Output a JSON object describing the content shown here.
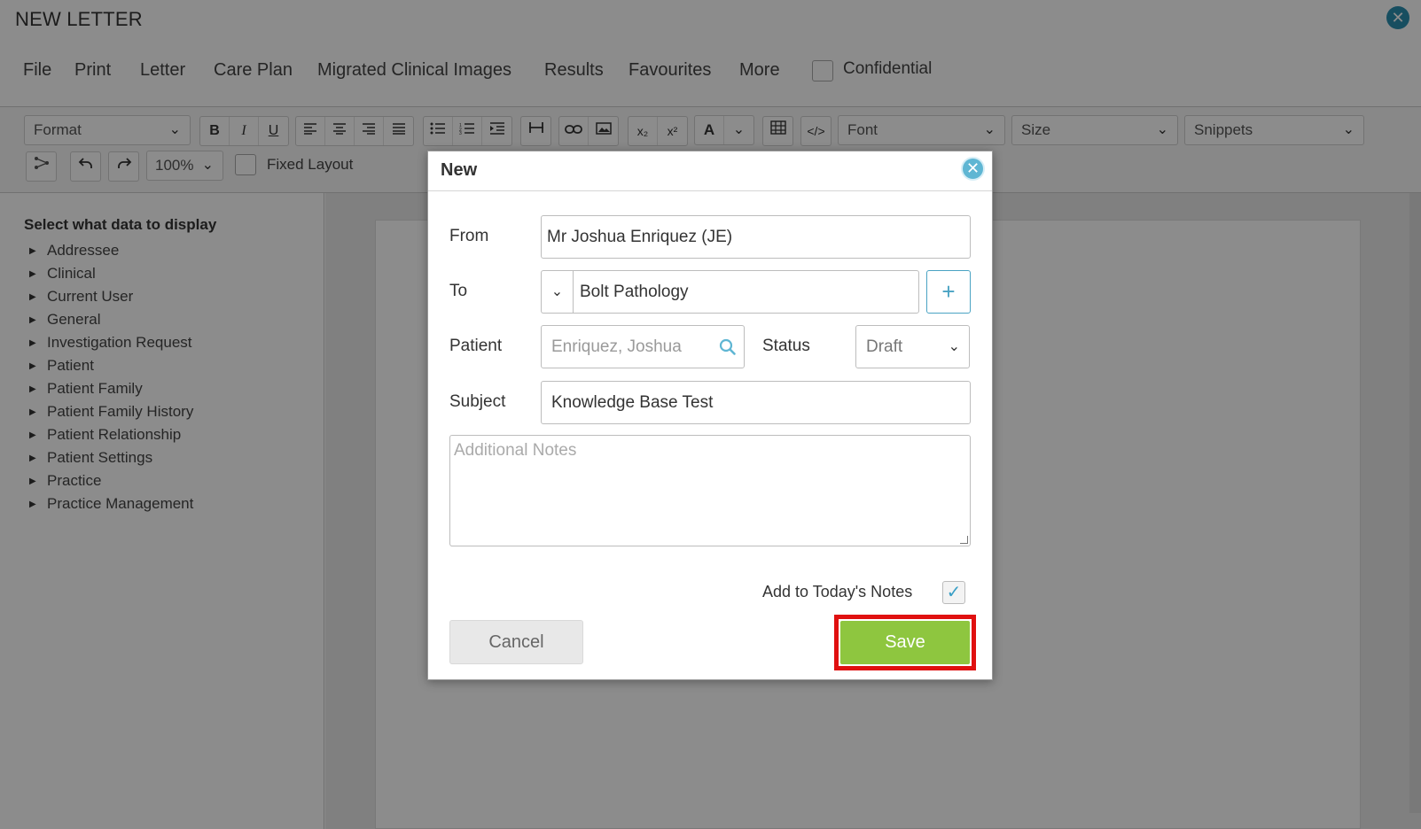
{
  "window": {
    "title": "NEW LETTER",
    "close_icon": "close-circle-icon"
  },
  "menu": {
    "items": [
      "File",
      "Print",
      "Letter",
      "Care Plan",
      "Migrated Clinical Images",
      "Results",
      "Favourites",
      "More"
    ],
    "confidential_label": "Confidential",
    "confidential_checked": false
  },
  "toolbar": {
    "format_select": "Format",
    "font_select": "Font",
    "size_select": "Size",
    "snippets_select": "Snippets",
    "zoom": "100%",
    "fixed_layout_label": "Fixed Layout",
    "fixed_layout_checked": false,
    "bold": "B",
    "italic": "I",
    "underline": "U",
    "font_color": "A",
    "subscript": "x₂",
    "superscript": "x²"
  },
  "sidebar": {
    "heading": "Select what data to display",
    "items": [
      "Addressee",
      "Clinical",
      "Current User",
      "General",
      "Investigation Request",
      "Patient",
      "Patient Family",
      "Patient Family History",
      "Patient Relationship",
      "Patient Settings",
      "Practice",
      "Practice Management"
    ]
  },
  "modal": {
    "title": "New",
    "from_label": "From",
    "from_value": "Mr Joshua Enriquez (JE)",
    "to_label": "To",
    "to_value": "Bolt Pathology",
    "add_recipient": "+",
    "patient_label": "Patient",
    "patient_placeholder": "Enriquez, Joshua",
    "status_label": "Status",
    "status_value": "Draft",
    "subject_label": "Subject",
    "subject_value": "Knowledge Base Test",
    "notes_placeholder": "Additional Notes",
    "add_to_notes_label": "Add to Today's Notes",
    "add_to_notes_checked": true,
    "cancel_label": "Cancel",
    "save_label": "Save"
  },
  "colors": {
    "accent": "#5fb6d3",
    "save_green": "#8ec63f",
    "highlight_red": "#e01010"
  }
}
